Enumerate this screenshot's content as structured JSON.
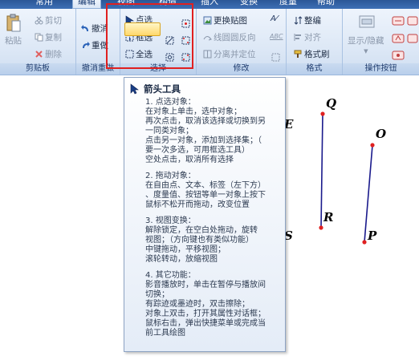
{
  "tabs": [
    "常用",
    "编辑",
    "视图",
    "构造",
    "插入",
    "变换",
    "度量",
    "帮助"
  ],
  "active_tab": 1,
  "clipboard": {
    "paste": "粘贴",
    "cut": "剪切",
    "copy": "复制",
    "delete": "删除",
    "label": "剪贴板"
  },
  "undo": {
    "undo": "撤消",
    "redo": "重做",
    "label": "撤消重做"
  },
  "select": {
    "point_select": "点选",
    "box_select": "框选",
    "select_all": "全选",
    "label": "选择"
  },
  "modify": {
    "replace_image": "更换贴图",
    "line_arc_reverse": "线圆圆反向",
    "split_merge": "分离并定位",
    "label": "修改"
  },
  "format": {
    "arrange": "整编",
    "align": "对齐",
    "format_brush": "格式刷",
    "label": "格式"
  },
  "action_buttons": {
    "show_hide": "显示/隐藏",
    "label": "操作按钮"
  },
  "tooltip": {
    "title": "箭头工具",
    "lines": [
      "1. 点选对象：",
      "在对象上单击，选中对象；",
      "再次点击，取消该选择或切换到另",
      "一同类对象；",
      "点击另一对象，添加到选择集；（",
      "要一次多选，可用框选工具）",
      "空处点击，取消所有选择",
      "",
      "2. 拖动对象：",
      "在自由点、文本、标签（左下方）",
      "、度量值、按钮等单一对象上按下",
      "鼠标不松开而拖动，改变位置",
      "",
      "3. 视图变换：",
      "解除锁定，在空白处拖动，旋转",
      "视图；（方向键也有类似功能）",
      "中键拖动，平移视图；",
      "滚轮转动，放缩视图",
      "",
      "4. 其它功能：",
      "影音播放时，单击在暂停与播放间",
      "切换；",
      "有踪迹或墨迹时，双击擦除；",
      "对象上双击，打开其属性对话框；",
      "鼠标右击，弹出快捷菜单或完成当",
      "前工具绘图"
    ]
  },
  "points": {
    "Q": "Q",
    "R": "R",
    "O": "O",
    "P": "P",
    "E": "E",
    "S": "S"
  },
  "colors": {
    "segment": "#1a1a8c",
    "point": "#e02020",
    "highlight_border": "#e02020"
  }
}
